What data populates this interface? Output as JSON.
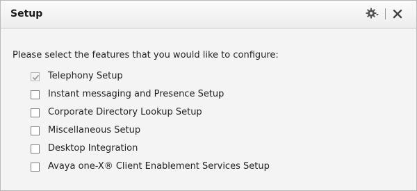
{
  "window": {
    "title": "Setup",
    "gear_icon": "gear-dropdown-icon",
    "close_icon": "close-icon"
  },
  "prompt": "Please select the features that you would like to configure:",
  "features": [
    {
      "label": "Telephony Setup",
      "checked": true,
      "disabled": true
    },
    {
      "label": "Instant messaging and Presence Setup",
      "checked": false,
      "disabled": false
    },
    {
      "label": "Corporate Directory Lookup Setup",
      "checked": false,
      "disabled": false
    },
    {
      "label": "Miscellaneous Setup",
      "checked": false,
      "disabled": false
    },
    {
      "label": "Desktop Integration",
      "checked": false,
      "disabled": false
    },
    {
      "label": "Avaya one-X® Client Enablement Services Setup",
      "checked": false,
      "disabled": false
    }
  ],
  "colors": {
    "panel_background": "#f4f4f4",
    "header_background": "#eeeeee",
    "border": "#b9b9b9",
    "checkmark_disabled": "#9a9a9a"
  }
}
